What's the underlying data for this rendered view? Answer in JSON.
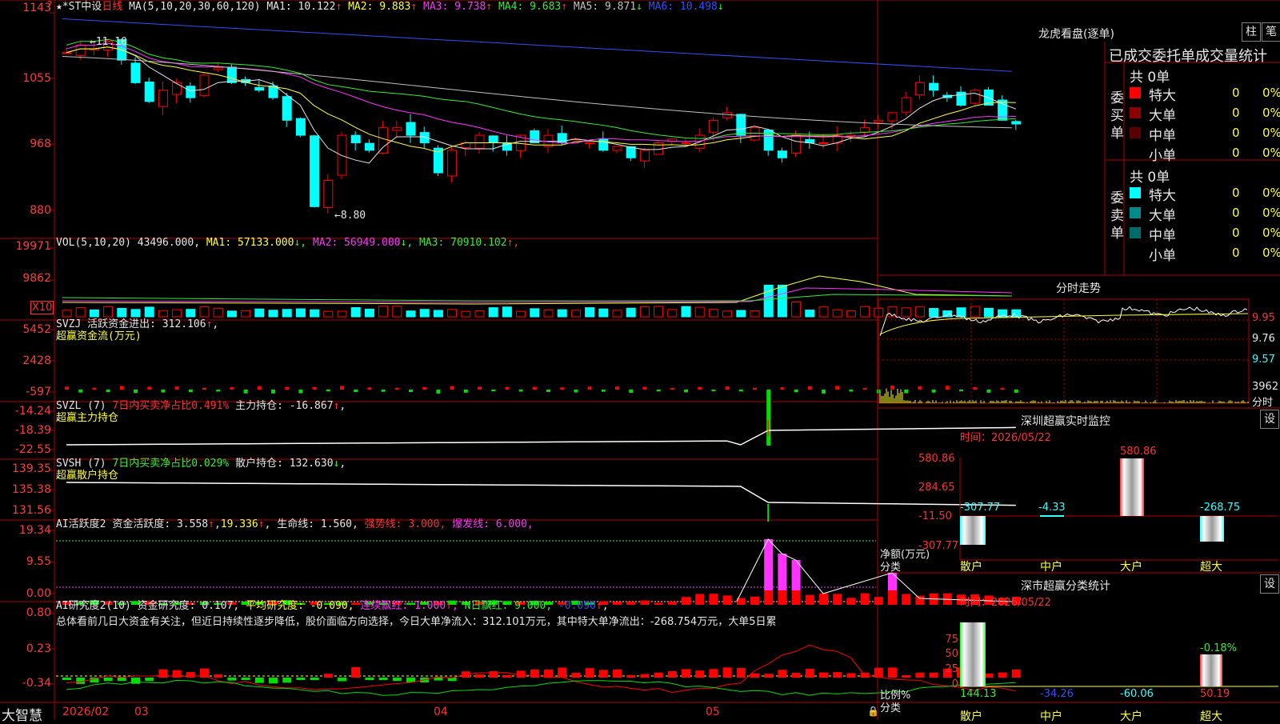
{
  "app": {
    "brand": "大智慧",
    "lock_icon": "lock-icon"
  },
  "stock": {
    "name": "★*ST中设",
    "period": "日线"
  },
  "price_panel": {
    "ma_header": "MA(5,10,20,30,60,120)",
    "mas": [
      {
        "label": "MA1:",
        "value": "10.122",
        "arrow": "↑",
        "color": "#e6e6e6"
      },
      {
        "label": "MA2:",
        "value": "9.883",
        "arrow": "↑",
        "color": "#ffff33"
      },
      {
        "label": "MA3:",
        "value": "9.738",
        "arrow": "↑",
        "color": "#ff33ff"
      },
      {
        "label": "MA4:",
        "value": "9.683",
        "arrow": "↑",
        "color": "#33ee33"
      },
      {
        "label": "MA5:",
        "value": "9.871",
        "arrow": "↓",
        "color": "#c0c0c0"
      },
      {
        "label": "MA6:",
        "value": "10.498",
        "arrow": "↓",
        "color": "#3050ff"
      }
    ],
    "y_ticks": [
      "1143",
      "1055",
      "968",
      "880"
    ],
    "high_marker": "←11.10",
    "low_marker": "←8.80"
  },
  "vol_panel": {
    "header": "VOL(5,10,20)",
    "value": "43496.000",
    "mas": [
      {
        "label": "MA1:",
        "value": "57133.000",
        "arrow": "↓",
        "color": "#ffff33"
      },
      {
        "label": "MA2:",
        "value": "56949.000",
        "arrow": "↓",
        "color": "#ff33ff"
      },
      {
        "label": "MA3:",
        "value": "70910.102",
        "arrow": "↑",
        "color": "#33ee33"
      }
    ],
    "y_ticks": [
      "19971",
      "9862"
    ],
    "unit": "X10"
  },
  "svzj": {
    "header": "SVZJ",
    "label": "活跃资金进出:",
    "value": "312.106",
    "arrow": "↑",
    "sub": "超赢资金流(万元)",
    "y_ticks": [
      "5452",
      "2428",
      "-597"
    ]
  },
  "svzl": {
    "header": "SVZL (7)",
    "label1": "7日内买卖净占比0.491%",
    "label2": "主力持仓:",
    "value": "-16.867",
    "arrow": "↑",
    "sub": "超赢主力持仓",
    "y_ticks": [
      "-14.24",
      "-18.39",
      "-22.55"
    ]
  },
  "svsh": {
    "header": "SVSH (7)",
    "label1": "7日内买卖净占比0.029%",
    "label2": "散户持仓:",
    "value": "132.630",
    "arrow": "↓",
    "sub": "超赢散户持仓",
    "y_ticks": [
      "139.35",
      "135.38",
      "131.56"
    ]
  },
  "ai_active": {
    "header": "AI活跃度2",
    "label": "资金活跃度:",
    "value1": "3.558",
    "value2": "19.336",
    "life_label": "生命线:",
    "life_value": "1.560",
    "strong_label": "强势线:",
    "strong_value": "3.000",
    "burst_label": "爆发线:",
    "burst_value": "6.000",
    "y_ticks": [
      "19.34",
      "9.55",
      "0.00"
    ]
  },
  "ai_research": {
    "header": "AI研究度2(10)",
    "label": "资金研究度:",
    "value": "0.107",
    "avg_label": "平均研究度:",
    "avg_value": "-0.090",
    "streak_label": "连续飘红:",
    "streak_value": "1.000",
    "nday_label": "N日飘红:",
    "nday_value": "9.000",
    "nday_value2": "-0.090",
    "summary": "总体看前几日大资金有关注，但近日持续性逐步降低，股价面临方向选择，今日大单净流入：312.101万元，其中特大单净流出：-268.754万元，大单5日累",
    "y_ticks": [
      "0.80",
      "0.23",
      "-0.34"
    ]
  },
  "x_axis": {
    "labels": [
      "2026/02",
      "03",
      "04",
      "05"
    ]
  },
  "dragon": {
    "title": "龙虎看盘(逐单)",
    "btn_bar": "柱",
    "btn_stroke": "笔",
    "tab_done": "已成交",
    "tab_order": "委托单",
    "tab_stats": "成交量统计",
    "buy_side": "委买单",
    "sell_side": "委卖单",
    "buy_total": "共 0单",
    "sell_total": "共 0单",
    "buy_rows": [
      {
        "label": "特大",
        "count": "0",
        "pct": "0%",
        "color": "#ff0000"
      },
      {
        "label": "大单",
        "count": "0",
        "pct": "0%",
        "color": "#8b0000"
      },
      {
        "label": "中单",
        "count": "0",
        "pct": "0%",
        "color": "#5a0000"
      },
      {
        "label": "小单",
        "count": "0",
        "pct": "0%",
        "color": ""
      }
    ],
    "sell_rows": [
      {
        "label": "特大",
        "count": "0",
        "pct": "0%",
        "color": "#00ffff"
      },
      {
        "label": "大单",
        "count": "0",
        "pct": "0%",
        "color": "#008b8b"
      },
      {
        "label": "中单",
        "count": "0",
        "pct": "0%",
        "color": "#006b6b"
      },
      {
        "label": "小单",
        "count": "0",
        "pct": "0%",
        "color": ""
      }
    ]
  },
  "intraday": {
    "title": "分时走势",
    "price_ticks": [
      "9.95",
      "9.76",
      "9.57"
    ],
    "vol_tick": "3962",
    "vol_label": "分时"
  },
  "sz_monitor": {
    "title": "深圳超赢实时监控",
    "setting": "设",
    "time_label": "时间：",
    "time": "2026/05/22",
    "y_ticks": [
      "580.86",
      "284.65",
      "-11.50",
      "-307.77"
    ],
    "y_label": "净额(万元)",
    "x_label": "分类",
    "categories": [
      "散户",
      "中户",
      "大户",
      "超大"
    ],
    "values": [
      -307.77,
      -4.33,
      580.86,
      -268.75
    ],
    "value_labels": [
      "-307.77",
      "-4.33",
      "580.86",
      "-268.75"
    ]
  },
  "sz_stats": {
    "title": "深市超赢分类统计",
    "setting": "设",
    "time_label": "时间：",
    "time": "2026/05/22",
    "y_ticks": [
      "75",
      "50",
      "25",
      "0"
    ],
    "y_label": "比例%",
    "x_label": "分类",
    "categories": [
      "散户",
      "中户",
      "大户",
      "超大"
    ],
    "bottom_values": [
      "144.13",
      "-34.26",
      "-60.06",
      "50.19"
    ],
    "top_value": "-0.18%"
  }
}
